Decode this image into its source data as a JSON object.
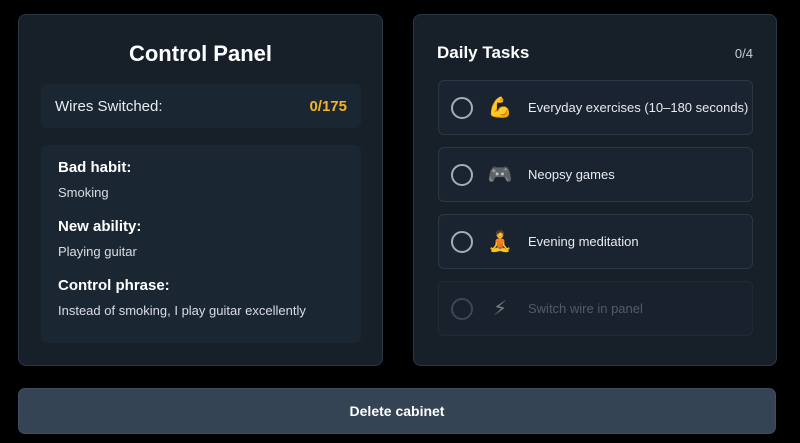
{
  "control_panel": {
    "title": "Control Panel",
    "wires_label": "Wires Switched:",
    "wires_value": "0/175",
    "bad_habit_label": "Bad habit:",
    "bad_habit_value": "Smoking",
    "new_ability_label": "New ability:",
    "new_ability_value": "Playing guitar",
    "control_phrase_label": "Control phrase:",
    "control_phrase_value": "Instead of smoking, I play guitar excellently"
  },
  "daily_tasks": {
    "title": "Daily Tasks",
    "count": "0/4",
    "items": [
      {
        "icon": "flexed-biceps-icon",
        "glyph": "💪",
        "label": "Everyday exercises (10–180 seconds)",
        "completed": false,
        "disabled": false
      },
      {
        "icon": "game-controller-icon",
        "glyph": "🎮",
        "label": "Neopsy games",
        "completed": false,
        "disabled": false
      },
      {
        "icon": "meditation-icon",
        "glyph": "🧘",
        "label": "Evening meditation",
        "completed": false,
        "disabled": false
      },
      {
        "icon": "lightning-icon",
        "glyph": "⚡",
        "label": "Switch wire in panel",
        "completed": false,
        "disabled": true
      }
    ]
  },
  "actions": {
    "delete_label": "Delete cabinet"
  },
  "colors": {
    "accent": "#f5b324",
    "panel_bg": "#172029",
    "button_bg": "#344454"
  }
}
